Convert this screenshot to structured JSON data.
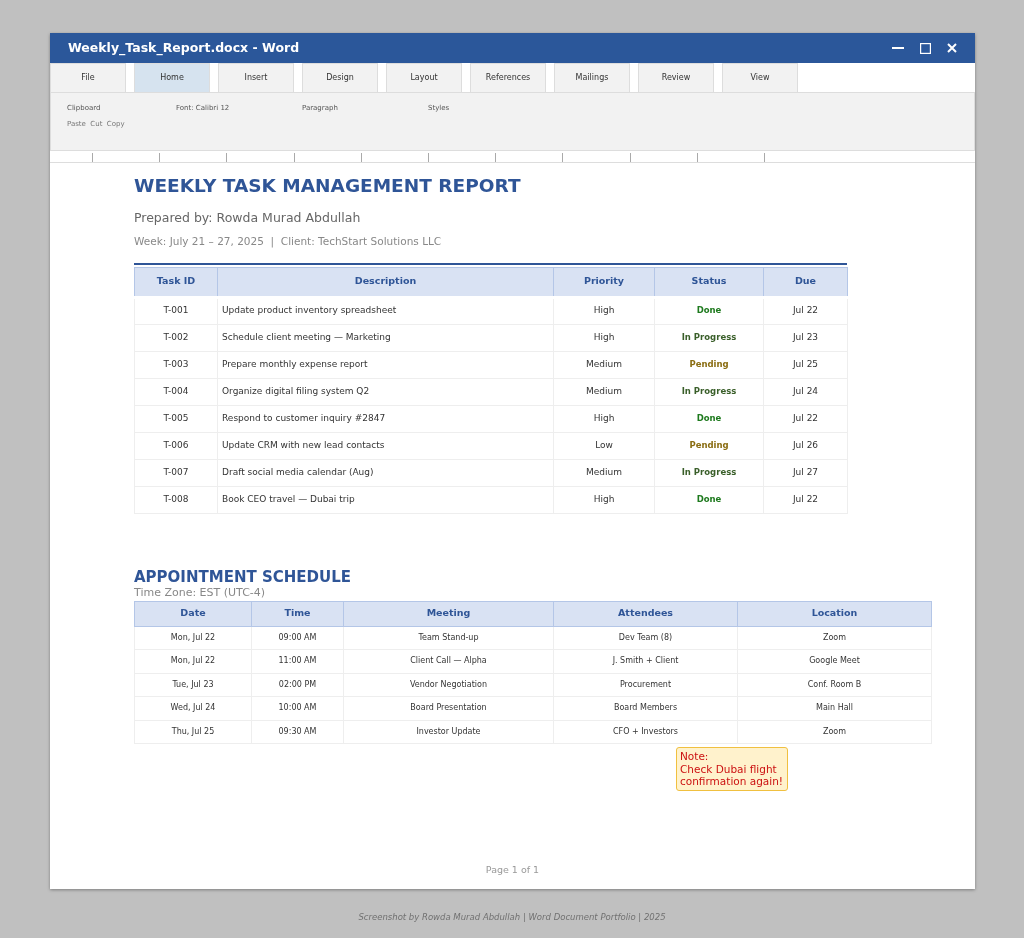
{
  "window": {
    "title": "Weekly_Task_Report.docx - Word"
  },
  "tabs": [
    {
      "label": "File",
      "selected": false
    },
    {
      "label": "Home",
      "selected": true
    },
    {
      "label": "Insert",
      "selected": false
    },
    {
      "label": "Design",
      "selected": false
    },
    {
      "label": "Layout",
      "selected": false
    },
    {
      "label": "References",
      "selected": false
    },
    {
      "label": "Mailings",
      "selected": false
    },
    {
      "label": "Review",
      "selected": false
    },
    {
      "label": "View",
      "selected": false
    }
  ],
  "ribbon": {
    "groups": [
      "Clipboard",
      "Font: Calibri 12",
      "Paragraph",
      "Styles"
    ],
    "commands": "Paste  Cut  Copy"
  },
  "document": {
    "title": "WEEKLY TASK MANAGEMENT REPORT",
    "prepared_by": "Prepared by: Rowda Murad Abdullah",
    "week_line": "Week: July 21 – 27, 2025  |  Client: TechStart Solutions LLC",
    "task_table": {
      "columns": [
        "Task ID",
        "Description",
        "Priority",
        "Status",
        "Due"
      ],
      "rows": [
        {
          "id": "T-001",
          "description": "Update product inventory spreadsheet",
          "priority": "High",
          "status": "Done",
          "color": "#1e7a1e",
          "due": "Jul 22"
        },
        {
          "id": "T-002",
          "description": "Schedule client meeting — Marketing",
          "priority": "High",
          "status": "In Progress",
          "color": "#3a5f2a",
          "due": "Jul 23"
        },
        {
          "id": "T-003",
          "description": "Prepare monthly expense report",
          "priority": "Medium",
          "status": "Pending",
          "color": "#8a6d12",
          "due": "Jul 25"
        },
        {
          "id": "T-004",
          "description": "Organize digital filing system Q2",
          "priority": "Medium",
          "status": "In Progress",
          "color": "#3a5f2a",
          "due": "Jul 24"
        },
        {
          "id": "T-005",
          "description": "Respond to customer inquiry #2847",
          "priority": "High",
          "status": "Done",
          "color": "#1e7a1e",
          "due": "Jul 22"
        },
        {
          "id": "T-006",
          "description": "Update CRM with new lead contacts",
          "priority": "Low",
          "status": "Pending",
          "color": "#8a6d12",
          "due": "Jul 26"
        },
        {
          "id": "T-007",
          "description": "Draft social media calendar (Aug)",
          "priority": "Medium",
          "status": "In Progress",
          "color": "#3a5f2a",
          "due": "Jul 27"
        },
        {
          "id": "T-008",
          "description": "Book CEO travel — Dubai trip",
          "priority": "High",
          "status": "Done",
          "color": "#1e7a1e",
          "due": "Jul 22"
        }
      ]
    },
    "schedule_title": "APPOINTMENT SCHEDULE",
    "time_zone": "Time Zone: EST (UTC-4)",
    "appointment_table": {
      "columns": [
        "Date",
        "Time",
        "Meeting",
        "Attendees",
        "Location"
      ],
      "rows": [
        [
          "Mon, Jul 22",
          "09:00 AM",
          "Team Stand-up",
          "Dev Team (8)",
          "Zoom"
        ],
        [
          "Mon, Jul 22",
          "11:00 AM",
          "Client Call — Alpha",
          "J. Smith + Client",
          "Google Meet"
        ],
        [
          "Tue, Jul 23",
          "02:00 PM",
          "Vendor Negotiation",
          "Procurement",
          "Conf. Room B"
        ],
        [
          "Wed, Jul 24",
          "10:00 AM",
          "Board Presentation",
          "Board Members",
          "Main Hall"
        ],
        [
          "Thu, Jul 25",
          "09:30 AM",
          "Investor Update",
          "CFO + Investors",
          "Zoom"
        ]
      ]
    },
    "note": {
      "label": "Note:",
      "text": "Check Dubai flight confirmation again!"
    },
    "page_number": "Page 1 of 1"
  },
  "caption": "Screenshot by Rowda Murad Abdullah | Word Document Portfolio | 2025"
}
